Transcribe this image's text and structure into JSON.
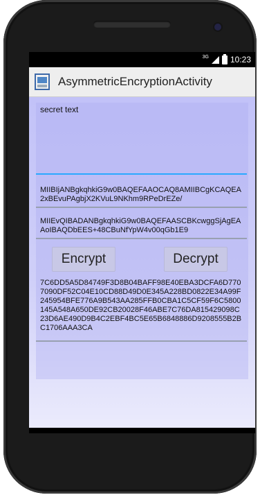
{
  "status_bar": {
    "network": "3G",
    "time": "10:23"
  },
  "app_bar": {
    "title": "AsymmetricEncryptionActivity"
  },
  "form": {
    "plain_text": "secret text",
    "public_key": "MIIBIjANBgkqhkiG9w0BAQEFAAOCAQ8AMIIBCgKCAQEA2xBEvuPAgbjX2KVuL9NKhm9RPeDrEZe/",
    "private_key": "MIIEvQIBADANBgkqhkiG9w0BAQEFAASCBKcwggSjAgEAAoIBAQDbEES+48CBuNfYpW4v00qGb1E9",
    "encrypt_label": "Encrypt",
    "decrypt_label": "Decrypt",
    "cipher_text": "7C6DD5A5D84749F3D8B04BAFF98E40EBA3DCFA6D7707090DF52C04E10CD88D49D0E345A228BD0822E34A99F245954BFE776A9B543AA285FFB0CBA1C5CF59F6C5800145A548A650DE92CB20028F46ABE7C76DA815429098C23D6AE490D9B4C2EBF4BC5E65B6848886D9208555B2BC1706AAA3CA"
  }
}
